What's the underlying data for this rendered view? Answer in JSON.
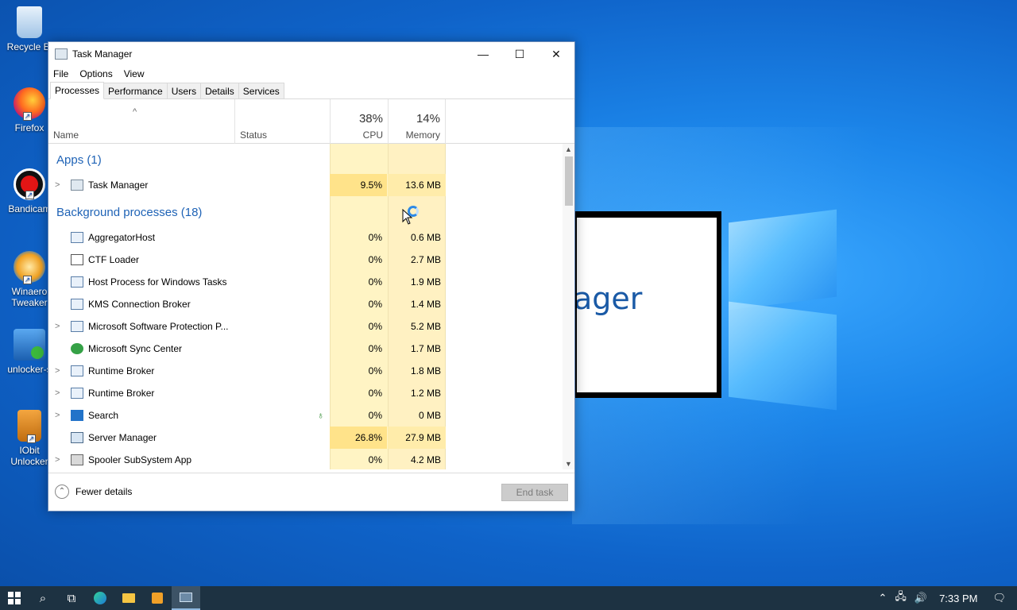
{
  "desktop": {
    "icons": [
      {
        "label": "Recycle Bi",
        "icon": "recycle-bin-icon"
      },
      {
        "label": "Firefox",
        "icon": "firefox-icon"
      },
      {
        "label": "Bandicam",
        "icon": "bandicam-icon"
      },
      {
        "label": "Winaero Tweaker",
        "icon": "winaero-icon"
      },
      {
        "label": "unlocker-s",
        "icon": "iobit-setup-icon"
      },
      {
        "label": "IObit Unlocker",
        "icon": "iobit-unlocker-icon"
      }
    ],
    "background_window_text": "ager"
  },
  "window": {
    "title": "Task Manager",
    "controls": {
      "minimize": "—",
      "maximize": "☐",
      "close": "✕"
    },
    "menu": [
      "File",
      "Options",
      "View"
    ],
    "tabs": [
      "Processes",
      "Performance",
      "Users",
      "Details",
      "Services"
    ],
    "active_tab": "Processes",
    "columns": {
      "name": "Name",
      "status": "Status",
      "cpu": {
        "label": "CPU",
        "total": "38%"
      },
      "memory": {
        "label": "Memory",
        "total": "14%"
      }
    },
    "groups": {
      "apps": "Apps (1)",
      "background": "Background processes (18)"
    },
    "apps": [
      {
        "name": "Task Manager",
        "cpu": "9.5%",
        "memory": "13.6 MB",
        "expandable": true
      }
    ],
    "background": [
      {
        "name": "AggregatorHost",
        "cpu": "0%",
        "memory": "0.6 MB",
        "expandable": false
      },
      {
        "name": "CTF Loader",
        "cpu": "0%",
        "memory": "2.7 MB",
        "expandable": false
      },
      {
        "name": "Host Process for Windows Tasks",
        "cpu": "0%",
        "memory": "1.9 MB",
        "expandable": false
      },
      {
        "name": "KMS Connection Broker",
        "cpu": "0%",
        "memory": "1.4 MB",
        "expandable": false
      },
      {
        "name": "Microsoft Software Protection P...",
        "cpu": "0%",
        "memory": "5.2 MB",
        "expandable": true
      },
      {
        "name": "Microsoft Sync Center",
        "cpu": "0%",
        "memory": "1.7 MB",
        "expandable": false
      },
      {
        "name": "Runtime Broker",
        "cpu": "0%",
        "memory": "1.8 MB",
        "expandable": true
      },
      {
        "name": "Runtime Broker",
        "cpu": "0%",
        "memory": "1.2 MB",
        "expandable": true
      },
      {
        "name": "Search",
        "cpu": "0%",
        "memory": "0 MB",
        "expandable": true,
        "status_icon": "leaf-icon"
      },
      {
        "name": "Server Manager",
        "cpu": "26.8%",
        "memory": "27.9 MB",
        "expandable": false
      },
      {
        "name": "Spooler SubSystem App",
        "cpu": "0%",
        "memory": "4.2 MB",
        "expandable": true
      }
    ],
    "footer": {
      "fewer_details": "Fewer details",
      "end_task": "End task"
    }
  },
  "taskbar": {
    "clock": "7:33 PM"
  },
  "colors": {
    "cpu_light": "#fff4c4",
    "cpu_high": "#ffe38a",
    "mem_light": "#fff1c2",
    "group_blue": "#1f63b6",
    "taskbar": "#1d3242"
  }
}
